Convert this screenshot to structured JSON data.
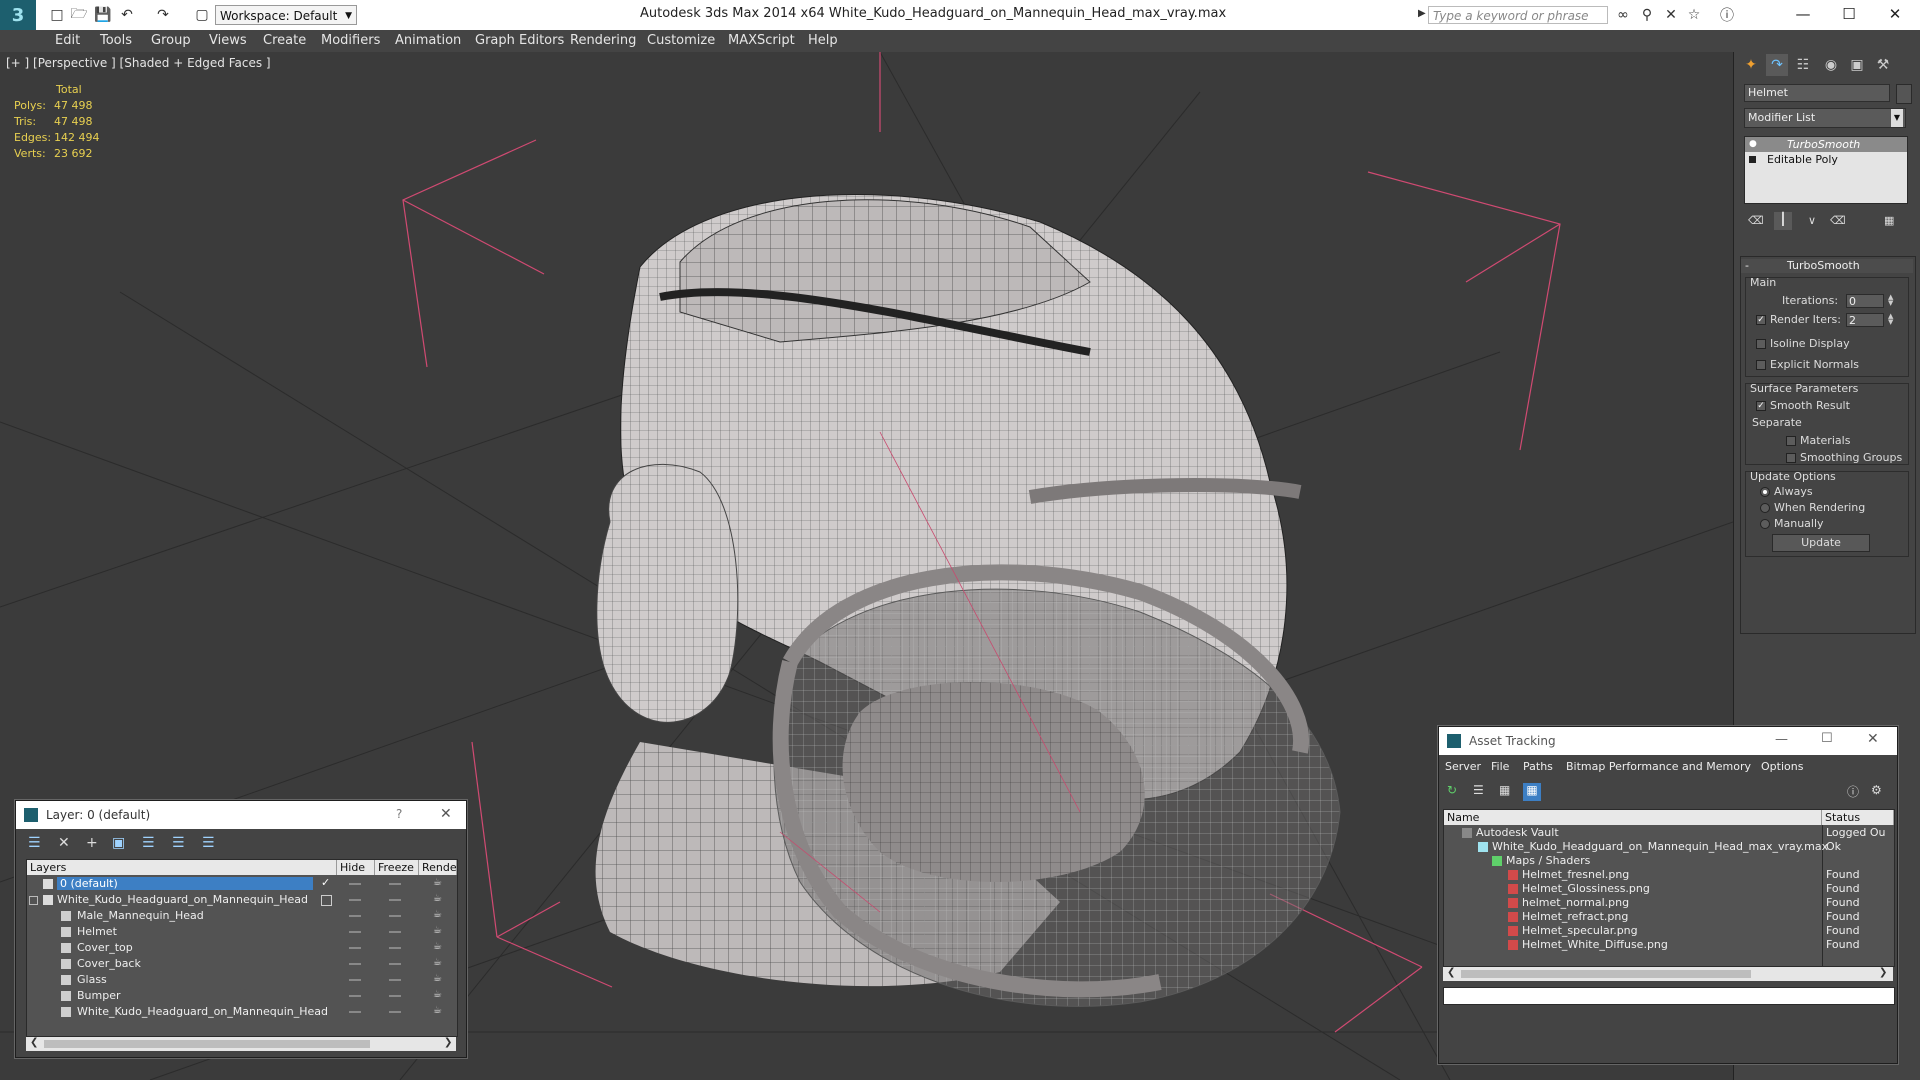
{
  "window": {
    "title": "Autodesk 3ds Max  2014 x64      White_Kudo_Headguard_on_Mannequin_Head_max_vray.max",
    "workspace": "Workspace: Default",
    "search_placeholder": "Type a keyword or phrase"
  },
  "menu": [
    "Edit",
    "Tools",
    "Group",
    "Views",
    "Create",
    "Modifiers",
    "Animation",
    "Graph Editors",
    "Rendering",
    "Customize",
    "MAXScript",
    "Help"
  ],
  "viewport": {
    "label": "[+ ] [Perspective ] [Shaded + Edged Faces ]",
    "stats": {
      "header": "Total",
      "rows": [
        {
          "label": "Polys:",
          "value": "47 498"
        },
        {
          "label": "Tris:",
          "value": "47 498"
        },
        {
          "label": "Edges:",
          "value": "142 494"
        },
        {
          "label": "Verts:",
          "value": "23 692"
        }
      ]
    }
  },
  "command_panel": {
    "object_name": "Helmet",
    "modifier_list": "Modifier List",
    "stack": [
      "TurboSmooth",
      "Editable Poly"
    ],
    "rollout_title": "TurboSmooth",
    "main_group": "Main",
    "iterations_label": "Iterations:",
    "iterations_value": "0",
    "render_iters_label": "Render Iters:",
    "render_iters_value": "2",
    "isoline_label": "Isoline Display",
    "explicit_normals_label": "Explicit Normals",
    "surface_group": "Surface Parameters",
    "smooth_result_label": "Smooth Result",
    "separate_label": "Separate",
    "materials_label": "Materials",
    "smoothing_groups_label": "Smoothing Groups",
    "update_group": "Update Options",
    "update_options": [
      "Always",
      "When Rendering",
      "Manually"
    ],
    "update_button": "Update"
  },
  "layer_dialog": {
    "title": "Layer: 0 (default)",
    "help": "?",
    "columns": [
      "Layers",
      "Hide",
      "Freeze",
      "Rende"
    ],
    "rows": [
      {
        "name": "0 (default)",
        "indent": 0
      },
      {
        "name": "White_Kudo_Headguard_on_Mannequin_Head",
        "indent": 0
      },
      {
        "name": "Male_Mannequin_Head",
        "indent": 1
      },
      {
        "name": "Helmet",
        "indent": 1
      },
      {
        "name": "Cover_top",
        "indent": 1
      },
      {
        "name": "Cover_back",
        "indent": 1
      },
      {
        "name": "Glass",
        "indent": 1
      },
      {
        "name": "Bumper",
        "indent": 1
      },
      {
        "name": "White_Kudo_Headguard_on_Mannequin_Head",
        "indent": 1
      }
    ]
  },
  "asset_dialog": {
    "title": "Asset Tracking",
    "menu": [
      "Server",
      "File",
      "Paths",
      "Bitmap Performance and Memory",
      "Options"
    ],
    "columns": [
      "Name",
      "Status"
    ],
    "rows": [
      {
        "name": "Autodesk Vault",
        "status": "Logged Ou"
      },
      {
        "name": "White_Kudo_Headguard_on_Mannequin_Head_max_vray.max",
        "status": "Ok"
      },
      {
        "name": "Maps / Shaders",
        "status": ""
      },
      {
        "name": "Helmet_fresnel.png",
        "status": "Found"
      },
      {
        "name": "Helmet_Glossiness.png",
        "status": "Found"
      },
      {
        "name": "helmet_normal.png",
        "status": "Found"
      },
      {
        "name": "Helmet_refract.png",
        "status": "Found"
      },
      {
        "name": "Helmet_specular.png",
        "status": "Found"
      },
      {
        "name": "Helmet_White_Diffuse.png",
        "status": "Found"
      }
    ]
  }
}
